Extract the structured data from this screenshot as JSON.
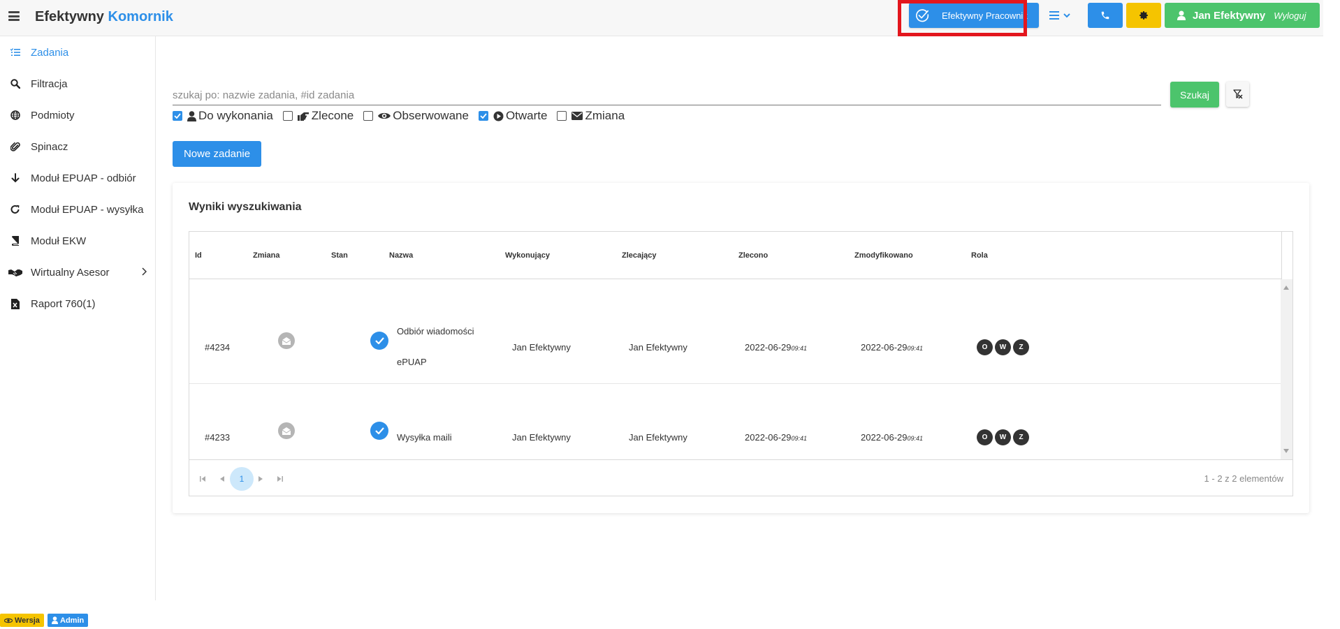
{
  "app": {
    "brand_main": "Efektywny",
    "brand_accent": "Komornik"
  },
  "header": {
    "workspace_button": "Efektywny Pracownik",
    "user_name": "Jan Efektywny",
    "logout_label": "Wyloguj"
  },
  "sidebar": {
    "items": [
      {
        "label": "Zadania",
        "icon": "list-check-icon"
      },
      {
        "label": "Filtracja",
        "icon": "search-icon"
      },
      {
        "label": "Podmioty",
        "icon": "globe-icon"
      },
      {
        "label": "Spinacz",
        "icon": "paperclip-icon"
      },
      {
        "label": "Moduł EPUAP - odbiór",
        "icon": "arrow-down-icon"
      },
      {
        "label": "Moduł EPUAP - wysyłka",
        "icon": "redo-icon"
      },
      {
        "label": "Moduł EKW",
        "icon": "book-icon"
      },
      {
        "label": "Wirtualny Asesor",
        "icon": "handshake-icon"
      },
      {
        "label": "Raport 760(1)",
        "icon": "excel-file-icon"
      }
    ]
  },
  "search": {
    "placeholder": "szukaj po: nazwie zadania, #id zadania",
    "value": "",
    "search_button": "Szukaj"
  },
  "filters": [
    {
      "label": "Do wykonania",
      "checked": true
    },
    {
      "label": "Zlecone",
      "checked": false
    },
    {
      "label": "Obserwowane",
      "checked": false
    },
    {
      "label": "Otwarte",
      "checked": true
    },
    {
      "label": "Zmiana",
      "checked": false
    }
  ],
  "new_task_button": "Nowe zadanie",
  "results": {
    "title": "Wyniki wyszukiwania",
    "columns": [
      "Id",
      "Zmiana",
      "Stan",
      "Nazwa",
      "Wykonujący",
      "Zlecający",
      "Zlecono",
      "Zmodyfikowano",
      "Rola"
    ],
    "rows": [
      {
        "id": "#4234",
        "name_line1": "Odbiór wiadomości",
        "name_line2": "ePUAP",
        "executor": "Jan Efektywny",
        "assigner": "Jan Efektywny",
        "assigned_date": "2022-06-29",
        "assigned_time": "09:41",
        "modified_date": "2022-06-29",
        "modified_time": "09:41",
        "roles": [
          "O",
          "W",
          "Z"
        ]
      },
      {
        "id": "#4233",
        "name_line1": "Wysyłka maili",
        "name_line2": "",
        "executor": "Jan Efektywny",
        "assigner": "Jan Efektywny",
        "assigned_date": "2022-06-29",
        "assigned_time": "09:41",
        "modified_date": "2022-06-29",
        "modified_time": "09:41",
        "roles": [
          "O",
          "W",
          "Z"
        ]
      }
    ],
    "pager": {
      "current_page": "1",
      "info": "1 - 2 z 2 elementów"
    }
  },
  "footer": {
    "version_badge": "Wersja",
    "role_badge": "Admin"
  },
  "colors": {
    "primary": "#2d8fe8",
    "success": "#4cc46c",
    "warning": "#f5c400",
    "highlight": "#e3161d"
  }
}
